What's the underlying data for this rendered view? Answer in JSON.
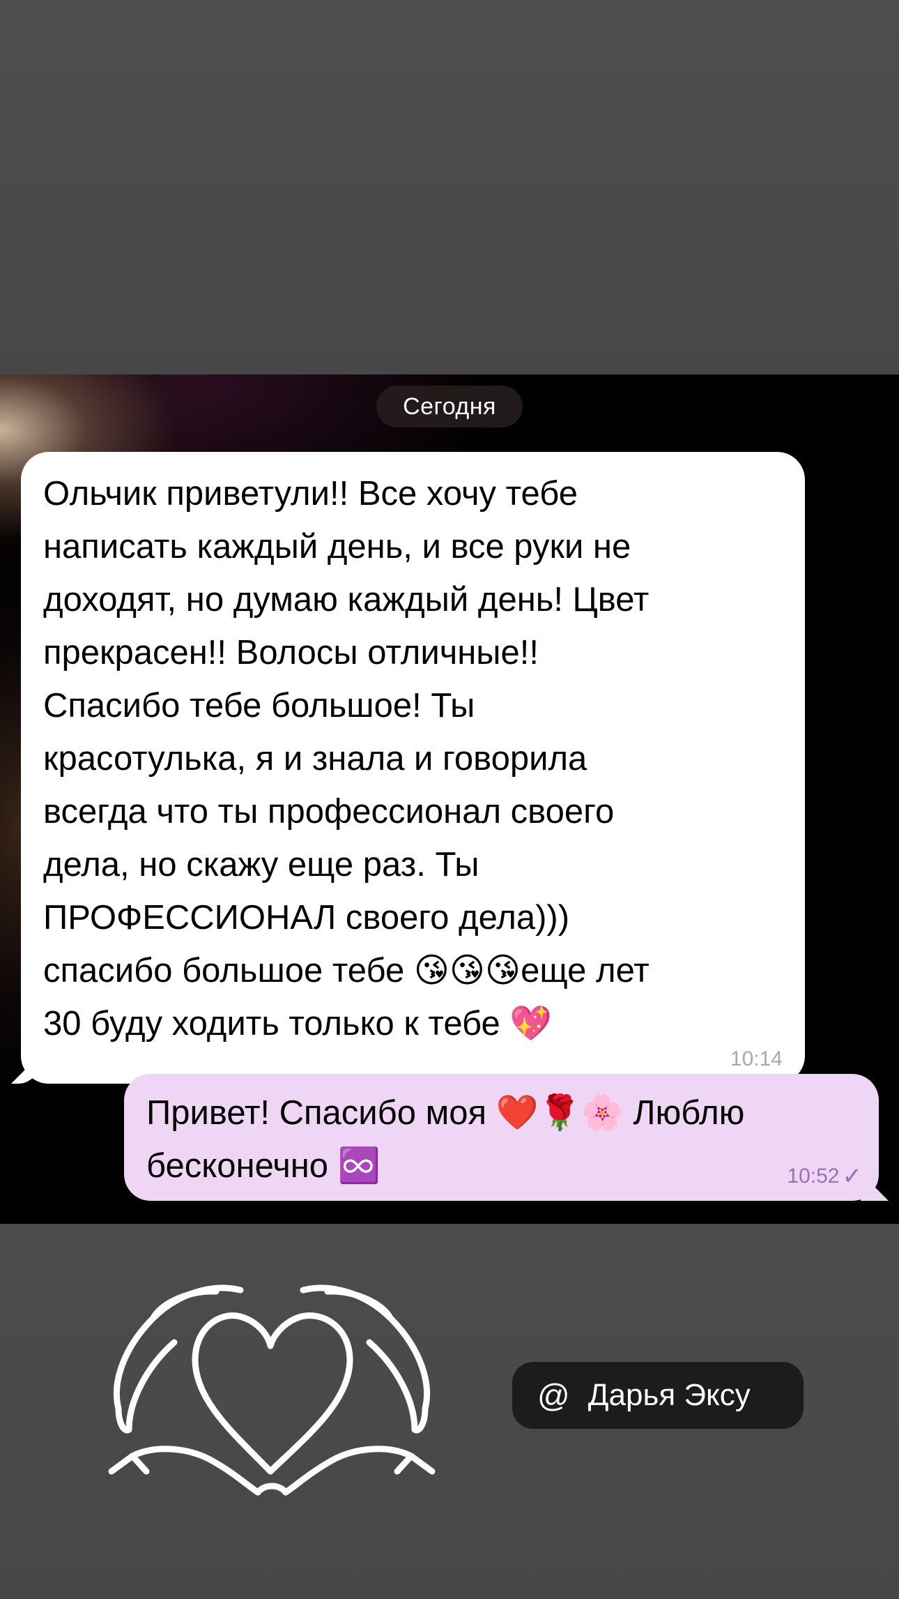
{
  "chat": {
    "date_label": "Сегодня",
    "messages": [
      {
        "direction": "incoming",
        "text": "Ольчик приветули!! Все хочу тебе\nнаписать каждый день, и все руки не\nдоходят, но думаю каждый день! Цвет\nпрекрасен!! Волосы отличные!!\nСпасибо тебе большое! Ты\nкрасотулька, я и знала и говорила\nвсегда что ты профессионал своего\nдела, но скажу еще раз. Ты\nПРОФЕССИОНАЛ своего дела)))\nспасибо большое тебе 😘😘😘еще лет\n30 буду ходить только к тебе 💖",
        "time": "10:14"
      },
      {
        "direction": "outgoing",
        "text": "Привет! Спасибо моя ❤️🌹🌸 Люблю\nбесконечно ♾️",
        "time": "10:52",
        "status_icon": "single-check-icon"
      }
    ]
  },
  "story": {
    "mention": "Дарья Эксу",
    "mention_icon": "at-sign-icon",
    "sticker_icon": "hands-heart-icon"
  },
  "colors": {
    "incoming_bubble": "#ffffff",
    "outgoing_bubble": "#efd6f4",
    "outgoing_time": "#9b6fb3"
  }
}
